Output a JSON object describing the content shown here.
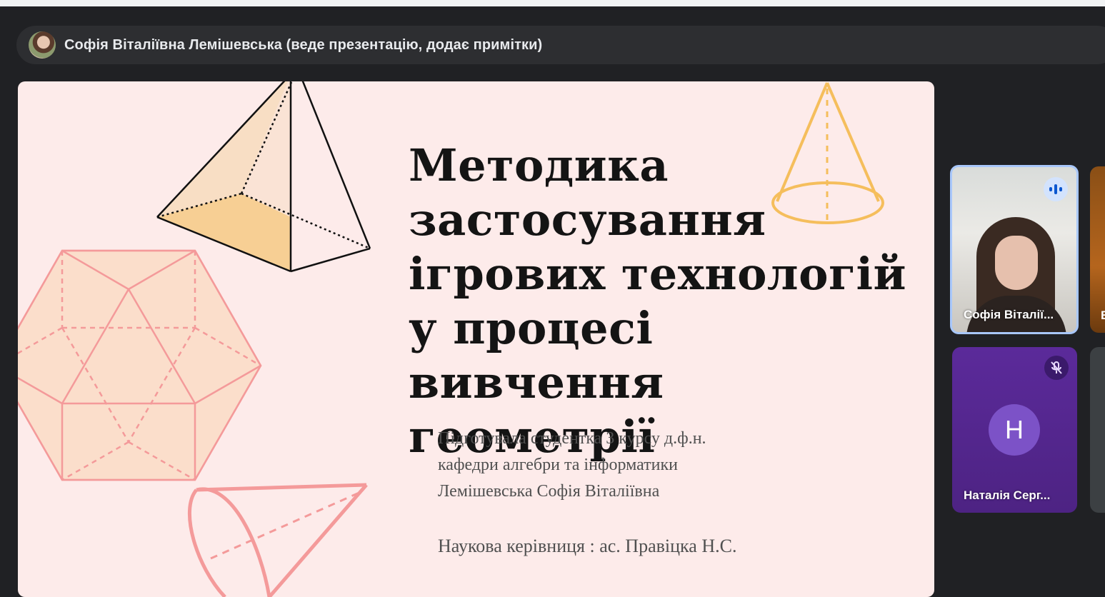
{
  "presenter": {
    "text": "Софія Віталіївна Лемішевська (веде презентацію, додає примітки)"
  },
  "slide": {
    "title_lines": [
      "Методика",
      "застосування",
      "ігрових технологій",
      "у процесі вивчення",
      "геометрії"
    ],
    "subtitle_lines": [
      "Підготувала студентка 3 курсу д.ф.н.",
      "кафедри алгебри та інформатики",
      "Лемішевська Софія Віталіївна"
    ],
    "supervisor": "Наукова керівниця : ас. Правіцка Н.С.",
    "colors": {
      "background": "#fdebea",
      "accent_orange": "#f5be5c",
      "accent_pink": "#f49a9a"
    }
  },
  "participants": [
    {
      "name": "Софія Віталії...",
      "status": "speaking",
      "icon": "audio-levels-icon"
    },
    {
      "name": "Наталія Серг...",
      "initial": "Н",
      "status": "muted",
      "icon": "mic-off-icon"
    },
    {
      "name": "В"
    }
  ]
}
